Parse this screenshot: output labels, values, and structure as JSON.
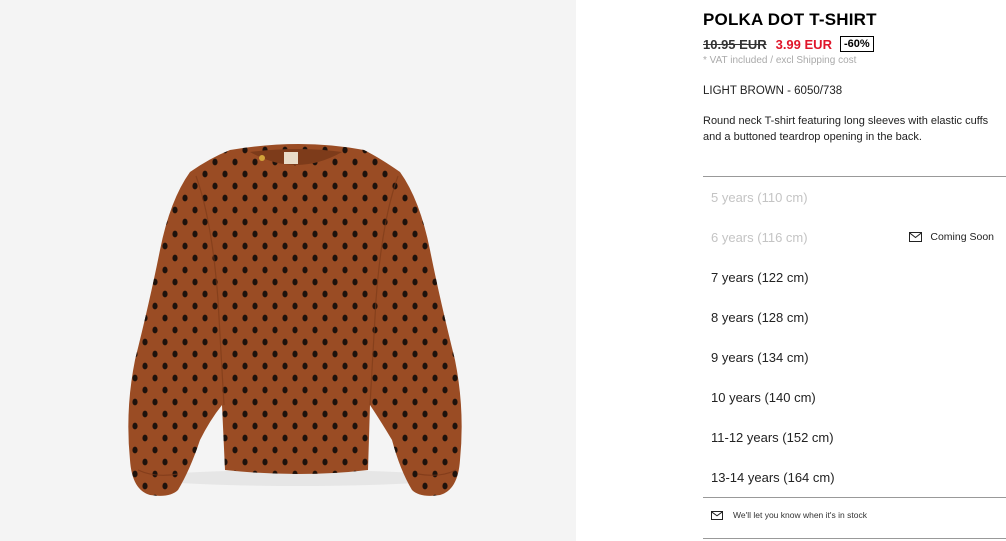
{
  "product": {
    "title": "POLKA DOT T-SHIRT",
    "old_price": "10.95 EUR",
    "new_price": "3.99 EUR",
    "discount": "-60%",
    "vat_note": "* VAT included / excl Shipping cost",
    "color_ref": "LIGHT BROWN - 6050/738",
    "description": "Round neck T-shirt featuring long sleeves with elastic cuffs and a buttoned teardrop opening in the back.",
    "image_icon": "polka-dot-shirt-photo"
  },
  "sizes": [
    {
      "label": "5 years (110 cm)",
      "available": false,
      "note": ""
    },
    {
      "label": "6 years (116 cm)",
      "available": false,
      "note": "Coming Soon"
    },
    {
      "label": "7 years (122 cm)",
      "available": true,
      "note": ""
    },
    {
      "label": "8 years (128 cm)",
      "available": true,
      "note": ""
    },
    {
      "label": "9 years (134 cm)",
      "available": true,
      "note": ""
    },
    {
      "label": "10 years (140 cm)",
      "available": true,
      "note": ""
    },
    {
      "label": "11-12 years (152 cm)",
      "available": true,
      "note": ""
    },
    {
      "label": "13-14 years (164 cm)",
      "available": true,
      "note": ""
    }
  ],
  "notify": {
    "text": "We'll let you know when it's in stock",
    "icon": "envelope-icon"
  },
  "colors": {
    "sale_red": "#e0152a",
    "shirt_brown": "#9a4c24",
    "dot": "#1e120c",
    "image_bg": "#f4f4f4"
  }
}
